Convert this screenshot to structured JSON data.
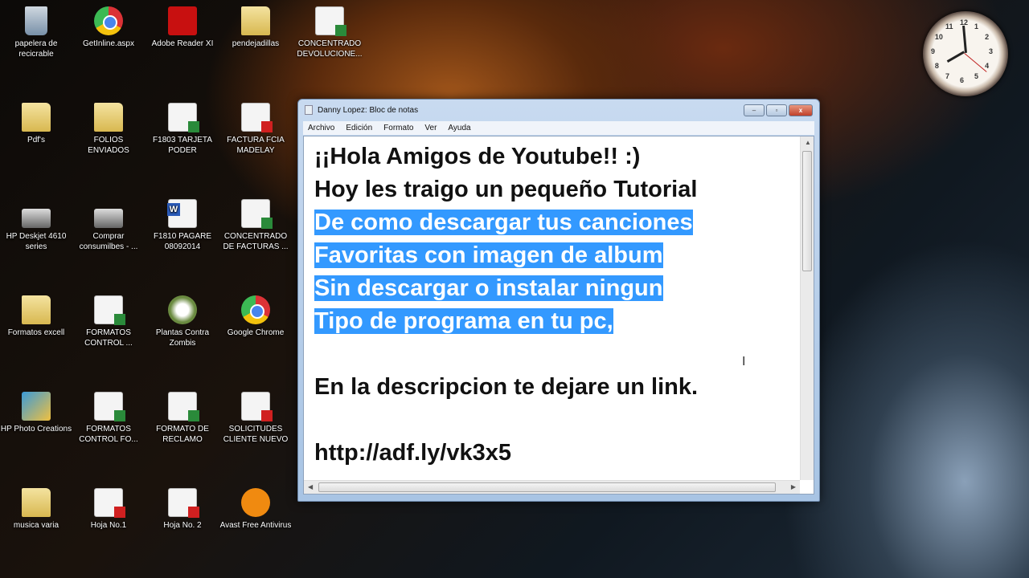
{
  "desktop_icons": [
    {
      "label": "papelera de recicrable",
      "icon": "recycle-bin-icon"
    },
    {
      "label": "GetInline.aspx",
      "icon": "chrome-icon"
    },
    {
      "label": "Adobe Reader XI",
      "icon": "adobe-reader-icon"
    },
    {
      "label": "pendejadillas",
      "icon": "folder-icon"
    },
    {
      "label": "CONCENTRADO DEVOLUCIONE...",
      "icon": "excel-file-icon"
    },
    {
      "label": "Pdf's",
      "icon": "folder-icon"
    },
    {
      "label": "FOLIOS ENVIADOS",
      "icon": "folder-icon"
    },
    {
      "label": "F1803 TARJETA PODER",
      "icon": "excel-file-icon"
    },
    {
      "label": "FACTURA FCIA MADELAY",
      "icon": "pdf-file-icon"
    },
    {
      "label": "HP Deskjet 4610 series",
      "icon": "printer-icon"
    },
    {
      "label": "Comprar consumilbes - ...",
      "icon": "printer-icon"
    },
    {
      "label": "F1810 PAGARE 08092014",
      "icon": "word-file-icon"
    },
    {
      "label": "CONCENTRADO DE FACTURAS ...",
      "icon": "excel-file-icon"
    },
    {
      "label": "Formatos excell",
      "icon": "folder-icon"
    },
    {
      "label": "FORMATOS CONTROL ...",
      "icon": "excel-file-icon"
    },
    {
      "label": "Plantas Contra Zombis",
      "icon": "game-icon"
    },
    {
      "label": "Google Chrome",
      "icon": "chrome-icon"
    },
    {
      "label": "HP Photo Creations",
      "icon": "photo-icon"
    },
    {
      "label": "FORMATOS CONTROL FO...",
      "icon": "excel-file-icon"
    },
    {
      "label": "FORMATO DE RECLAMO",
      "icon": "excel-file-icon"
    },
    {
      "label": "SOLICITUDES CLIENTE NUEVO",
      "icon": "pdf-file-icon"
    },
    {
      "label": "musica varia",
      "icon": "folder-icon"
    },
    {
      "label": "Hoja No.1",
      "icon": "pdf-file-icon"
    },
    {
      "label": "Hoja No. 2",
      "icon": "pdf-file-icon"
    },
    {
      "label": "Avast Free Antivirus",
      "icon": "avast-icon"
    }
  ],
  "notepad": {
    "title": "Danny Lopez: Bloc de notas",
    "minimize": "–",
    "maximize": "▫",
    "close": "x",
    "menu": [
      "Archivo",
      "Edición",
      "Formato",
      "Ver",
      "Ayuda"
    ],
    "lines": [
      "¡¡Hola Amigos de Youtube!! :)",
      "Hoy les traigo un pequeño Tutorial",
      "De como descargar tus canciones",
      "Favoritas con imagen de album",
      "Sin descargar o instalar ningun",
      "Tipo de programa en tu pc,",
      "",
      "En la descripcion te dejare un link.",
      "",
      "http://adf.ly/vk3x5"
    ],
    "selection_color": "#3399ff"
  },
  "clock": {
    "numbers": [
      "12",
      "1",
      "2",
      "3",
      "4",
      "5",
      "6",
      "7",
      "8",
      "9",
      "10",
      "11"
    ]
  }
}
